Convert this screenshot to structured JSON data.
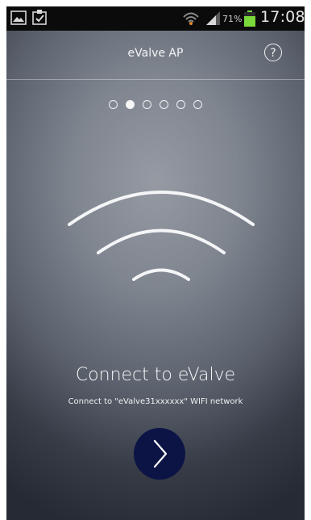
{
  "status_bar": {
    "battery_percent": "71%",
    "time": "17:08",
    "icons": [
      "gallery-icon",
      "clipboard-icon",
      "wifi-icon",
      "signal-icon",
      "battery-icon"
    ]
  },
  "header": {
    "title": "eValve AP",
    "help_symbol": "?"
  },
  "pager": {
    "total_pages": 6,
    "active_index": 1
  },
  "main": {
    "title": "Connect to eValve",
    "subtitle": "Connect to \"eValve31xxxxxx\" WIFI network",
    "next_icon": "chevron-right-icon"
  },
  "colors": {
    "status_bar": "#0b0b0c",
    "next_button": "#0c1446",
    "battery_fill": "#7bd83a"
  }
}
